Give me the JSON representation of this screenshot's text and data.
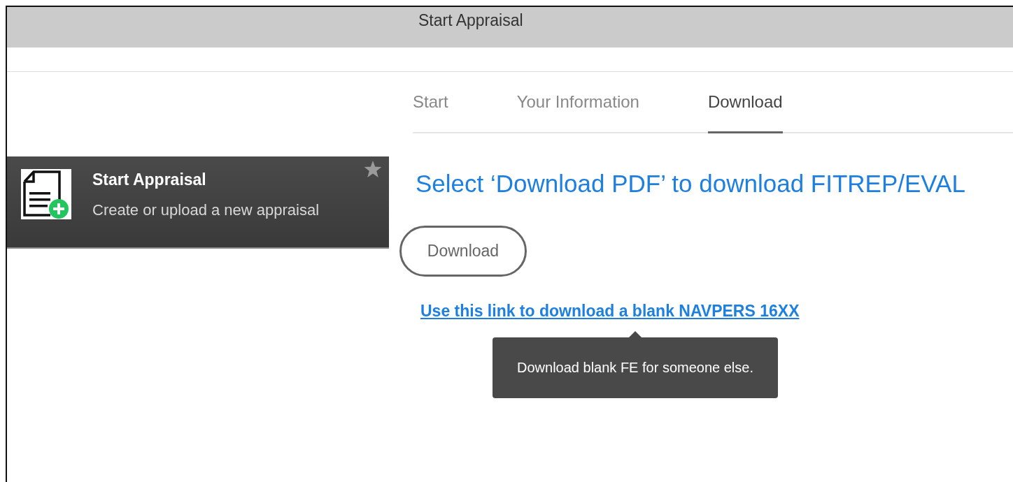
{
  "window": {
    "title": "Start Appraisal"
  },
  "sidebar_card": {
    "title": "Start Appraisal",
    "subtitle": "Create or upload a new appraisal"
  },
  "tabs": [
    {
      "label": "Start",
      "selected": false
    },
    {
      "label": "Your Information",
      "selected": false
    },
    {
      "label": "Download",
      "selected": true
    }
  ],
  "heading": "Select ‘Download PDF’ to download FITREP/EVAL",
  "download_button": "Download",
  "blank_form_link": "Use this link to download a blank NAVPERS 16XX",
  "tooltip": "Download blank FE for someone else."
}
